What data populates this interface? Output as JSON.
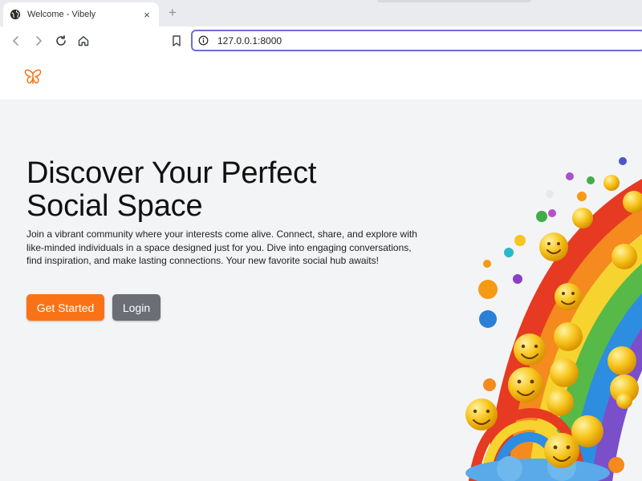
{
  "browser": {
    "tab_title": "Welcome - Vibely",
    "tab_close": "×",
    "new_tab": "+",
    "url": "127.0.0.1:8000"
  },
  "hero": {
    "title": "Discover Your Perfect Social Space",
    "description": "Join a vibrant community where your interests come alive. Connect, share, and explore with like-minded individuals in a space designed just for you. Dive into engaging conversations, find inspiration, and make lasting connections. Your new favorite social hub awaits!",
    "primary_button": "Get Started",
    "secondary_button": "Login"
  },
  "colors": {
    "accent": "#f97316",
    "secondary_button": "#6b6e75",
    "urlbar_border": "#6b6fd8"
  },
  "icons": [
    "globe-icon",
    "close-icon",
    "back-icon",
    "forward-icon",
    "reload-icon",
    "home-icon",
    "bookmark-icon",
    "site-info-icon",
    "butterfly-logo-icon"
  ]
}
